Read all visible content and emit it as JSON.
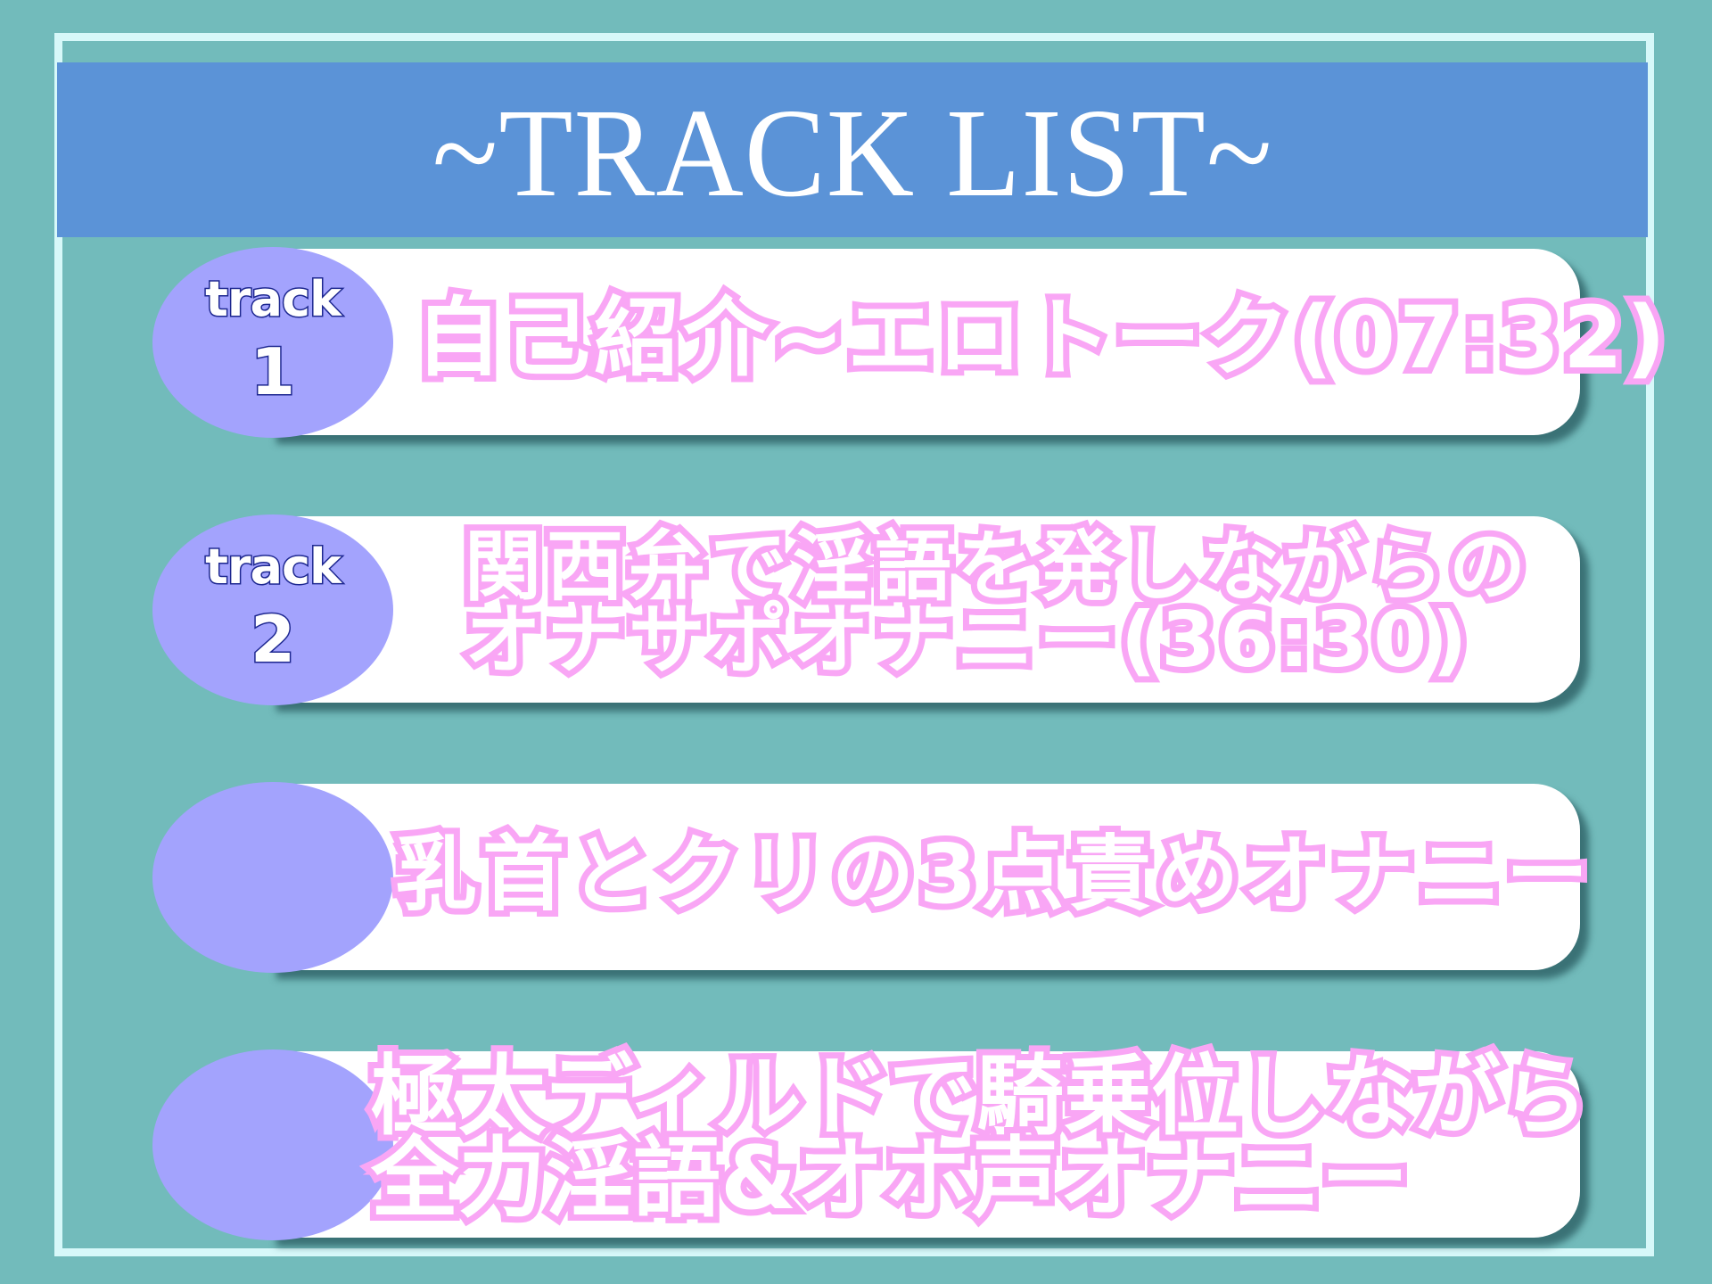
{
  "header": {
    "title": "~TRACK LIST~"
  },
  "colors": {
    "background": "#72bbbb",
    "frame": "#d7f8f9",
    "banner": "#5b93d7",
    "badge": "#a3a3fd",
    "badge_outline": "#1d2790",
    "title_outline": "#f9a6f5",
    "card": "#ffffff"
  },
  "tracks": [
    {
      "badge_word": "track",
      "number": "1",
      "lines": [
        "自己紹介~エロトーク(07:32)"
      ]
    },
    {
      "badge_word": "track",
      "number": "2",
      "lines": [
        "関西弁で淫語を発しながらの",
        "オナサポオナニー(36:30)"
      ]
    },
    {
      "badge_word": "",
      "number": "",
      "lines": [
        "乳首とクリの3点責めオナニー"
      ]
    },
    {
      "badge_word": "",
      "number": "",
      "lines": [
        "極太ディルドで騎乗位しながら",
        "全力淫語&オホ声オナニー"
      ]
    }
  ]
}
